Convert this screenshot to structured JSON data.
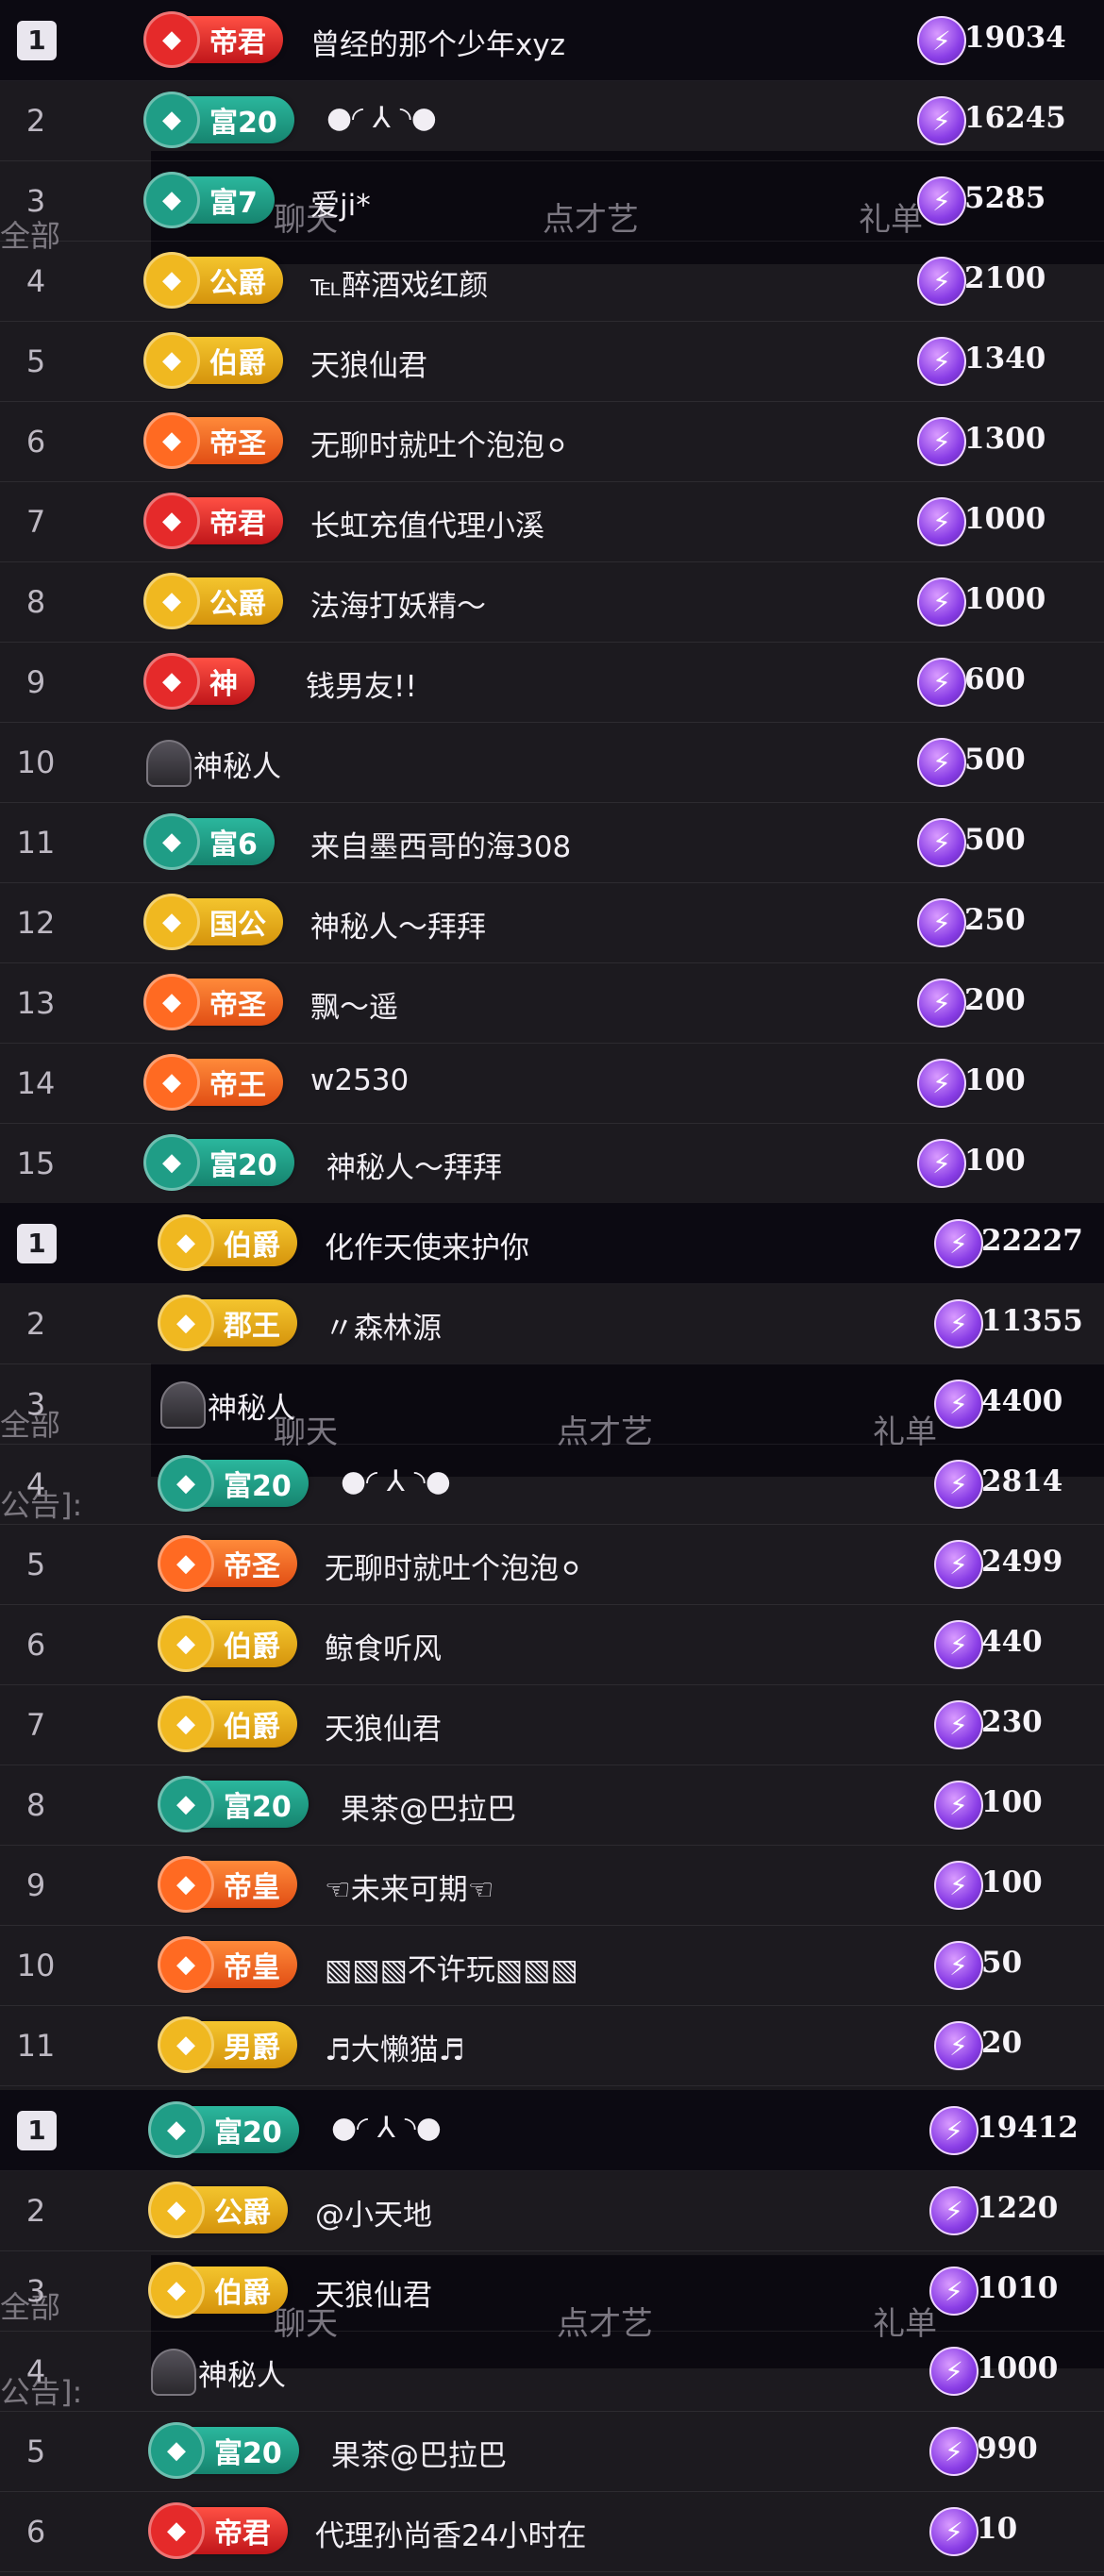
{
  "ghost": {
    "tabs": [
      "聊天",
      "点才艺",
      "礼单"
    ],
    "left_labels": [
      "全部",
      "公告]:"
    ]
  },
  "icons": {
    "coin": "lightning-coin-icon",
    "mystery": "mystery-user-icon"
  },
  "lists": [
    {
      "rows": [
        {
          "rank": "1",
          "badge_type": "red",
          "badge": "帝君",
          "name": "曾经的那个少年xyz",
          "score": "19034"
        },
        {
          "rank": "2",
          "badge_type": "fu",
          "badge": "富20",
          "name": "●◜ ⅄ ◝●",
          "score": "16245"
        },
        {
          "rank": "3",
          "badge_type": "fu",
          "badge": "富7",
          "name": "爱ji*",
          "score": "5285"
        },
        {
          "rank": "4",
          "badge_type": "gold",
          "badge": "公爵",
          "name": "℡醉酒戏红颜",
          "score": "2100"
        },
        {
          "rank": "5",
          "badge_type": "gold",
          "badge": "伯爵",
          "name": "天狼仙君",
          "score": "1340"
        },
        {
          "rank": "6",
          "badge_type": "orange",
          "badge": "帝圣",
          "name": "无聊时就吐个泡泡⚪",
          "score": "1300"
        },
        {
          "rank": "7",
          "badge_type": "red",
          "badge": "帝君",
          "name": "长虹充值代理小溪",
          "score": "1000"
        },
        {
          "rank": "8",
          "badge_type": "gold",
          "badge": "公爵",
          "name": "法海打妖精～",
          "score": "1000"
        },
        {
          "rank": "9",
          "badge_type": "red",
          "badge": "神",
          "name": "钱男友!!",
          "score": "600"
        },
        {
          "rank": "10",
          "badge_type": "mystery",
          "badge": "",
          "name": "神秘人",
          "score": "500"
        },
        {
          "rank": "11",
          "badge_type": "fu",
          "badge": "富6",
          "name": "来自墨西哥的海308",
          "score": "500"
        },
        {
          "rank": "12",
          "badge_type": "gold",
          "badge": "国公",
          "name": "神秘人～拜拜",
          "score": "250"
        },
        {
          "rank": "13",
          "badge_type": "orange",
          "badge": "帝圣",
          "name": "飘～遥",
          "score": "200"
        },
        {
          "rank": "14",
          "badge_type": "orange",
          "badge": "帝王",
          "name": "w2530",
          "score": "100"
        },
        {
          "rank": "15",
          "badge_type": "fu",
          "badge": "富20",
          "name": "神秘人～拜拜",
          "score": "100"
        }
      ]
    },
    {
      "rows": [
        {
          "rank": "1",
          "badge_type": "gold",
          "badge": "伯爵",
          "name": "化作天使来护你",
          "score": "22227"
        },
        {
          "rank": "2",
          "badge_type": "gold",
          "badge": "郡王",
          "name": "〃森林源",
          "score": "11355"
        },
        {
          "rank": "3",
          "badge_type": "mystery",
          "badge": "",
          "name": "神秘人",
          "score": "4400"
        },
        {
          "rank": "4",
          "badge_type": "fu",
          "badge": "富20",
          "name": "●◜ ⅄ ◝●",
          "score": "2814"
        },
        {
          "rank": "5",
          "badge_type": "orange",
          "badge": "帝圣",
          "name": "无聊时就吐个泡泡⚪",
          "score": "2499"
        },
        {
          "rank": "6",
          "badge_type": "gold",
          "badge": "伯爵",
          "name": "鲸食听风",
          "score": "440"
        },
        {
          "rank": "7",
          "badge_type": "gold",
          "badge": "伯爵",
          "name": "天狼仙君",
          "score": "230"
        },
        {
          "rank": "8",
          "badge_type": "fu",
          "badge": "富20",
          "name": "果茶@巴拉巴",
          "score": "100"
        },
        {
          "rank": "9",
          "badge_type": "orange",
          "badge": "帝皇",
          "name": "☜未来可期☜",
          "score": "100"
        },
        {
          "rank": "10",
          "badge_type": "orange",
          "badge": "帝皇",
          "name": "▧▧▧不许玩▧▧▧",
          "score": "50"
        },
        {
          "rank": "11",
          "badge_type": "gold",
          "badge": "男爵",
          "name": "♬大懒猫♬",
          "score": "20"
        }
      ]
    },
    {
      "rows": [
        {
          "rank": "1",
          "badge_type": "fu",
          "badge": "富20",
          "name": "●◜ ⅄ ◝●",
          "score": "19412"
        },
        {
          "rank": "2",
          "badge_type": "gold",
          "badge": "公爵",
          "name": "@小天地",
          "score": "1220"
        },
        {
          "rank": "3",
          "badge_type": "gold",
          "badge": "伯爵",
          "name": "天狼仙君",
          "score": "1010"
        },
        {
          "rank": "4",
          "badge_type": "mystery",
          "badge": "",
          "name": "神秘人",
          "score": "1000"
        },
        {
          "rank": "5",
          "badge_type": "fu",
          "badge": "富20",
          "name": "果茶@巴拉巴",
          "score": "990"
        },
        {
          "rank": "6",
          "badge_type": "red",
          "badge": "帝君",
          "name": "代理孙尚香24小时在",
          "score": "10"
        }
      ]
    }
  ]
}
